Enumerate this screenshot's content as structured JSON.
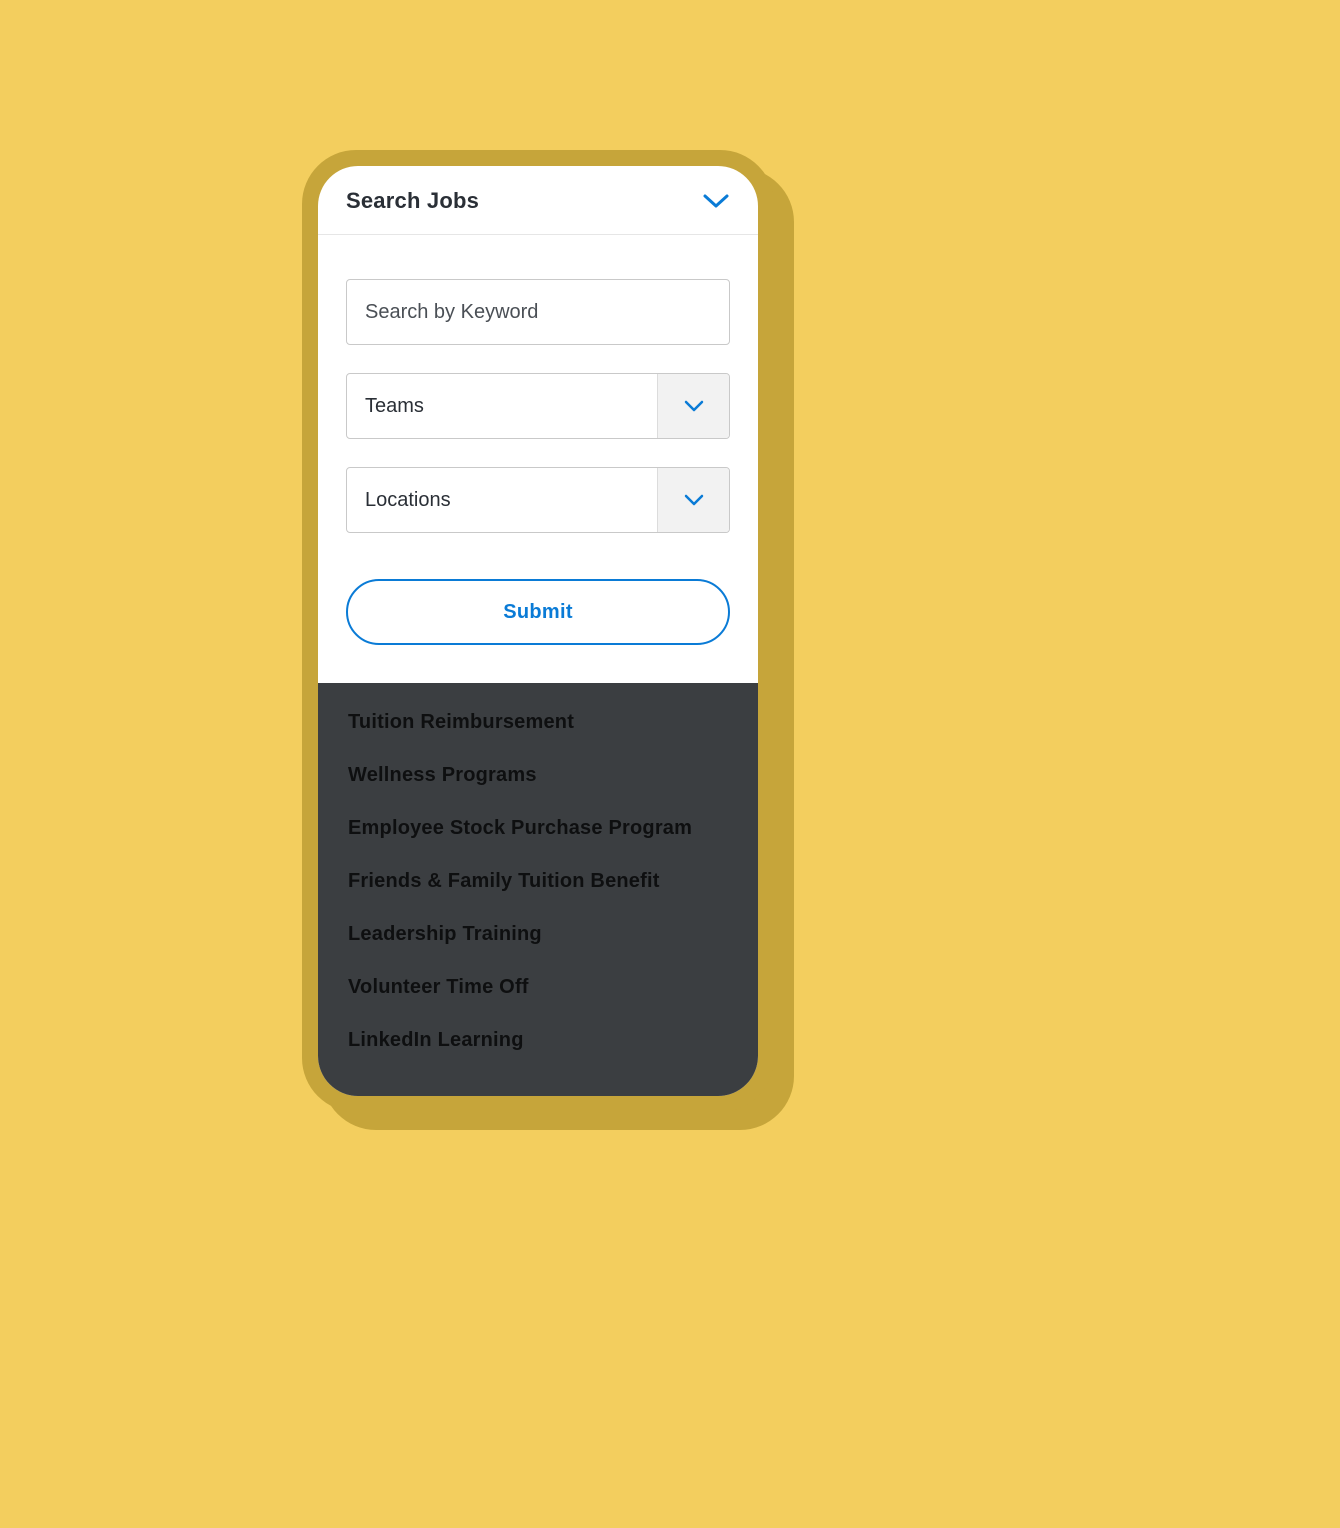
{
  "header": {
    "title": "Search Jobs"
  },
  "form": {
    "keyword_placeholder": "Search by Keyword",
    "teams_label": "Teams",
    "locations_label": "Locations",
    "submit_label": "Submit"
  },
  "benefits": [
    "Tuition Reimbursement",
    "Wellness Programs",
    "Employee Stock Purchase Program",
    "Friends & Family Tuition Benefit",
    "Leadership Training",
    "Volunteer Time Off",
    "LinkedIn Learning"
  ],
  "colors": {
    "accent_blue": "#0a7bd6",
    "bg_yellow": "#f3ce5e",
    "frame": "#c6a53a",
    "dark_panel": "#3b3e41"
  }
}
